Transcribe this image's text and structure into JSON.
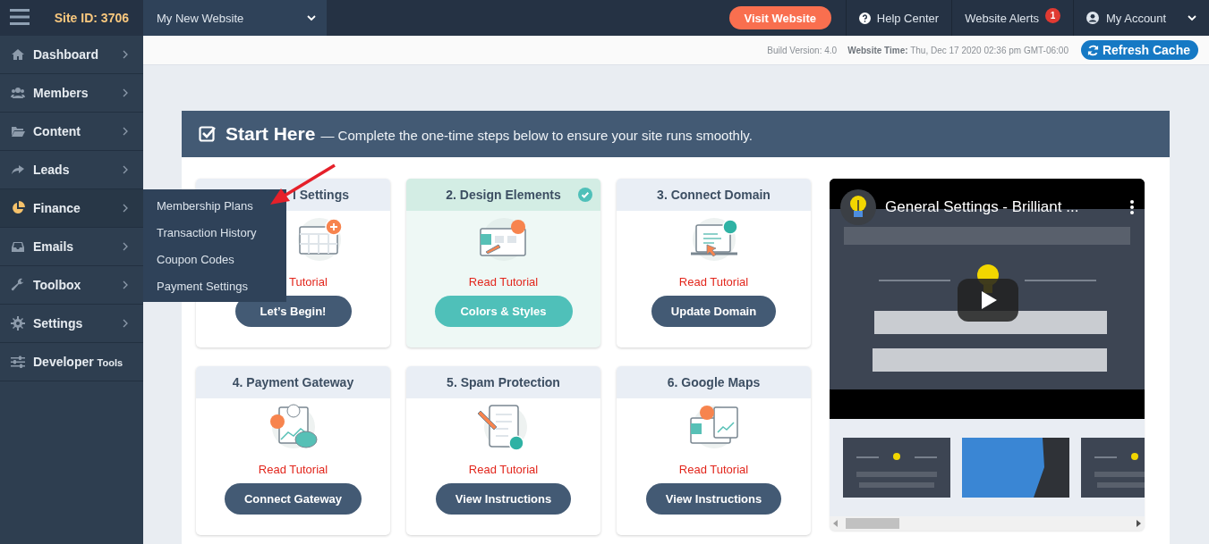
{
  "topbar": {
    "site_id": "Site ID: 3706",
    "site_select": "My New Website",
    "visit_button": "Visit Website",
    "help": "Help Center",
    "alerts": {
      "label": "Website Alerts",
      "count": "1"
    },
    "account": "My Account"
  },
  "infobar": {
    "build": "Build Version: 4.0",
    "time": "**Website Time:** Thu, Dec 17 2020 02:36 pm GMT-06:00",
    "refresh": "Refresh Cache"
  },
  "sidebar": {
    "items": [
      {
        "label": "Dashboard",
        "selected": false
      },
      {
        "label": "Members",
        "selected": false
      },
      {
        "label": "Content",
        "selected": false
      },
      {
        "label": "Leads",
        "selected": false
      },
      {
        "label": "Finance",
        "selected": true
      },
      {
        "label": "Emails",
        "selected": false
      },
      {
        "label": "Toolbox",
        "selected": false
      },
      {
        "label": "Settings",
        "selected": false
      },
      {
        "label": "Developer",
        "note": "Tools",
        "selected": false
      }
    ]
  },
  "flyout": {
    "items": [
      "Membership Plans",
      "Transaction History",
      "Coupon Codes",
      "Payment Settings"
    ]
  },
  "start_panel": {
    "title": "Start Here",
    "subtitle": "— Complete the one-time steps below to ensure your site runs smoothly.",
    "cards": [
      {
        "title": "l Settings",
        "link": "Tutorial",
        "button": "Let’s Begin!",
        "done": false,
        "partly_hidden": true
      },
      {
        "title": "2. Design Elements",
        "link": "Read Tutorial",
        "button": "Colors & Styles",
        "done": true,
        "partly_hidden": false
      },
      {
        "title": "3. Connect Domain",
        "link": "Read Tutorial",
        "button": "Update Domain",
        "done": false,
        "partly_hidden": false
      },
      {
        "title": "4. Payment Gateway",
        "link": "Read Tutorial",
        "button": "Connect Gateway",
        "done": false,
        "partly_hidden": false
      },
      {
        "title": "5. Spam Protection",
        "link": "Read Tutorial",
        "button": "View Instructions",
        "done": false,
        "partly_hidden": false
      },
      {
        "title": "6. Google Maps",
        "link": "Read Tutorial",
        "button": "View Instructions",
        "done": false,
        "partly_hidden": false
      }
    ],
    "video": {
      "title": "General Settings - Brilliant ..."
    }
  }
}
